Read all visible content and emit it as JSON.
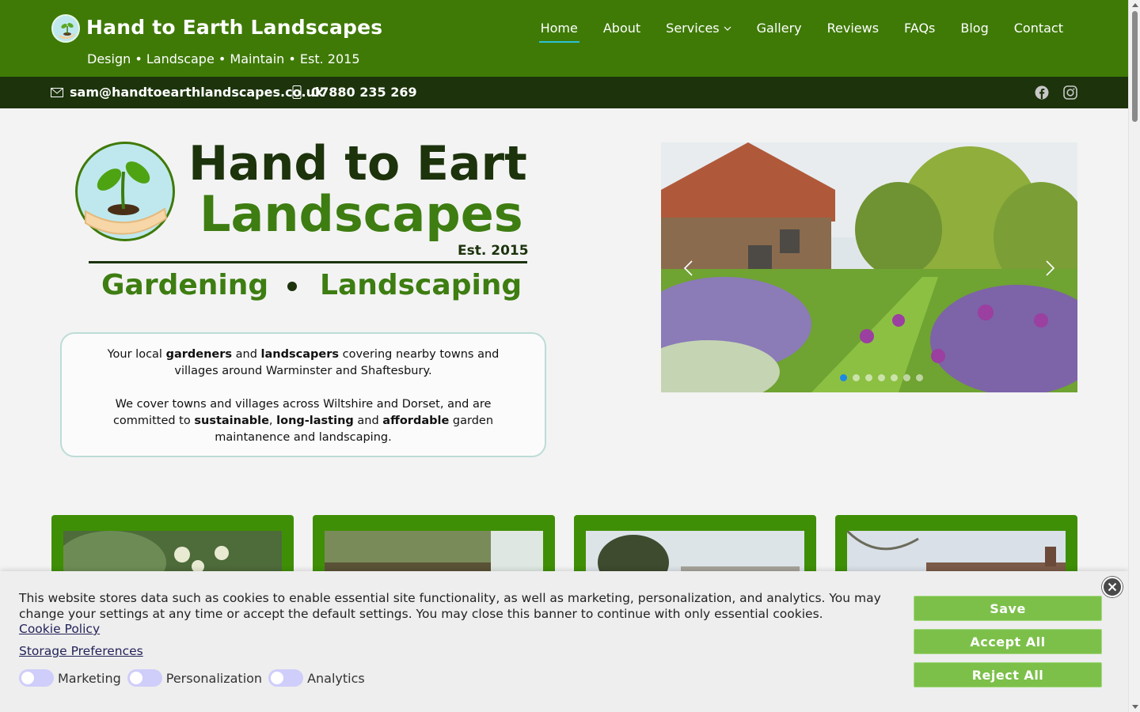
{
  "header": {
    "brand_title": "Hand to Earth Landscapes",
    "tagline": "Design • Landscape • Maintain • Est. 2015",
    "nav": [
      {
        "label": "Home",
        "active": true
      },
      {
        "label": "About"
      },
      {
        "label": "Services",
        "has_dropdown": true
      },
      {
        "label": "Gallery"
      },
      {
        "label": "Reviews"
      },
      {
        "label": "FAQs"
      },
      {
        "label": "Blog"
      },
      {
        "label": "Contact"
      }
    ]
  },
  "contact_bar": {
    "email": "sam@handtoearthlandscapes.co.uk",
    "phone": "07880 235 269",
    "social": [
      "facebook-icon",
      "instagram-icon"
    ]
  },
  "hero": {
    "logo_text": {
      "line1": "Hand to Earth",
      "line2": "Landscapes",
      "est": "Est. 2015",
      "sub_left": "Gardening",
      "sub_right": "Landscaping"
    },
    "intro": {
      "p1": {
        "a": "Your local ",
        "b": "gardeners",
        "c": " and ",
        "d": "landscapers",
        "e": " covering nearby towns and villages around Warminster and Shaftesbury."
      },
      "p2": {
        "a": "We cover towns and villages across Wiltshire and Dorset, and are committed to ",
        "b": "sustainable",
        "c": ", ",
        "d": "long-lasting",
        "e": " and ",
        "f": "affordable",
        "g": " garden maintanence and landscaping."
      }
    },
    "slider": {
      "slide_count": 7,
      "active_index": 0
    }
  },
  "cookie_banner": {
    "text": "This website stores data such as cookies to enable essential site functionality, as well as marketing, personalization, and analytics. You may change your settings at any time or accept the default settings. You may close this banner to continue with only essential cookies.",
    "policy_link": "Cookie Policy",
    "preferences_link": "Storage Preferences",
    "toggles": [
      "Marketing",
      "Personalization",
      "Analytics"
    ],
    "buttons": {
      "save": "Save",
      "accept": "Accept All",
      "reject": "Reject All"
    }
  },
  "colors": {
    "header_green": "#3f7a07",
    "contact_bar": "#1c330c",
    "card_green": "#3f8f06",
    "button_green": "#7cc04a",
    "accent_underline": "#2cc0d6"
  }
}
